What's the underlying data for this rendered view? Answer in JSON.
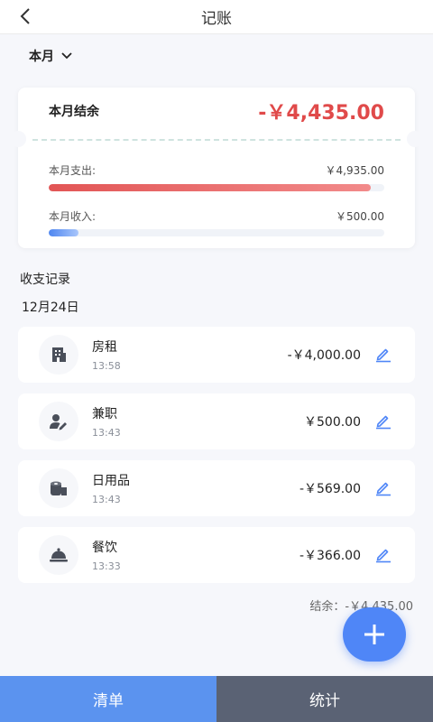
{
  "header": {
    "title": "记账",
    "back_icon": "back-arrow-icon"
  },
  "month_filter": {
    "label": "本月",
    "icon": "chevron-down-icon"
  },
  "summary": {
    "balance_label": "本月结余",
    "balance_value": "-￥4,435.00",
    "expense_label": "本月支出:",
    "expense_value": "￥4,935.00",
    "expense_ratio": 0.96,
    "income_label": "本月收入:",
    "income_value": "￥500.00",
    "income_ratio": 0.09,
    "colors": {
      "balance": "#e04a4a",
      "expense_bar": "#e25555",
      "income_bar": "#4e86f0"
    }
  },
  "records_section": {
    "title": "收支记录",
    "date": "12月24日",
    "items": [
      {
        "name": "房租",
        "time": "13:58",
        "amount": "-￥4,000.00",
        "icon": "building-icon"
      },
      {
        "name": "兼职",
        "time": "13:43",
        "amount": "￥500.00",
        "icon": "user-edit-icon"
      },
      {
        "name": "日用品",
        "time": "13:43",
        "amount": "-￥569.00",
        "icon": "tissue-roll-icon"
      },
      {
        "name": "餐饮",
        "time": "13:33",
        "amount": "-￥366.00",
        "icon": "dish-cover-icon"
      }
    ],
    "edit_icon": "pencil-icon"
  },
  "footer_balance": "结余：-￥4,435.00",
  "fab": {
    "icon": "plus-icon"
  },
  "bottom_nav": {
    "tabs": [
      {
        "label": "清单",
        "active": true
      },
      {
        "label": "统计",
        "active": false
      }
    ],
    "colors": {
      "active": "#5b93ef",
      "inactive": "#5a6274"
    }
  }
}
